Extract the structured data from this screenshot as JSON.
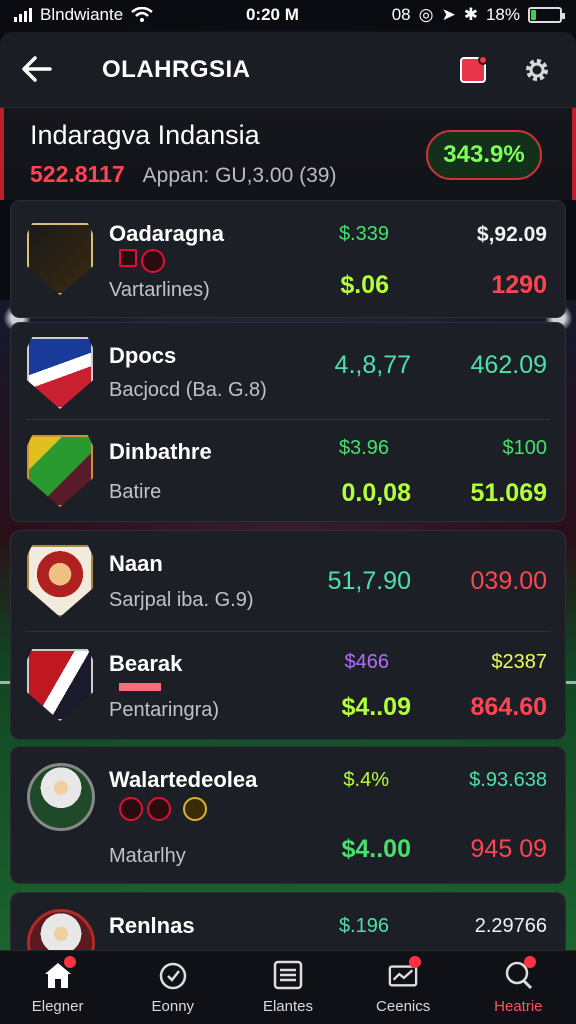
{
  "status": {
    "carrier": "Blndwiante",
    "time": "0:20 M",
    "right_text": "08",
    "battery": "18%",
    "battery_level": 0.18
  },
  "header": {
    "title": "OLAHRGSIA"
  },
  "summary": {
    "name": "Indaragva Indansia",
    "total": "522.8117",
    "detail": "Appan: GU,3.00 (39)",
    "pill": "343.9%",
    "colors": {
      "total": "#ff4452",
      "pill": "#7dff5a"
    }
  },
  "teams": [
    {
      "name": "Oadaragna",
      "sub": "Vartarlines)",
      "v1": "$.339",
      "v2": "$,92.09",
      "v3": "$.06",
      "v4": "1290"
    },
    {
      "name": "Dpocs",
      "sub": "Bacjocd (Ba. G.8)",
      "v1": "4.,8,77",
      "v2": "462.09"
    },
    {
      "name": "Dinbathre",
      "sub": "Batire",
      "v1": "$3.96",
      "v2": "$100",
      "v3": "0.0,08",
      "v4": "51.069"
    },
    {
      "name": "Naan",
      "sub": "Sarjpal iba. G.9)",
      "v1": "51,7.90",
      "v2": "039.00"
    },
    {
      "name": "Bearak",
      "sub": "Pentaringra)",
      "v1": "$466",
      "v2": "$2387",
      "v3": "$4..09",
      "v4": "864.60"
    },
    {
      "name": "Walartedeolea",
      "sub": "Matarlhy",
      "v1": "$.4%",
      "v2": "$.93.638",
      "v3": "$4..00",
      "v4": "945 09"
    },
    {
      "name": "Renlnas",
      "sub": "",
      "v1": "$.196",
      "v2": "2.29766"
    }
  ],
  "nav": [
    {
      "label": "Elegner",
      "icon": "home-icon"
    },
    {
      "label": "Eonny",
      "icon": "timer-icon"
    },
    {
      "label": "Elantes",
      "icon": "list-icon"
    },
    {
      "label": "Ceenics",
      "icon": "chart-icon"
    },
    {
      "label": "Heatrie",
      "icon": "search-icon"
    }
  ]
}
